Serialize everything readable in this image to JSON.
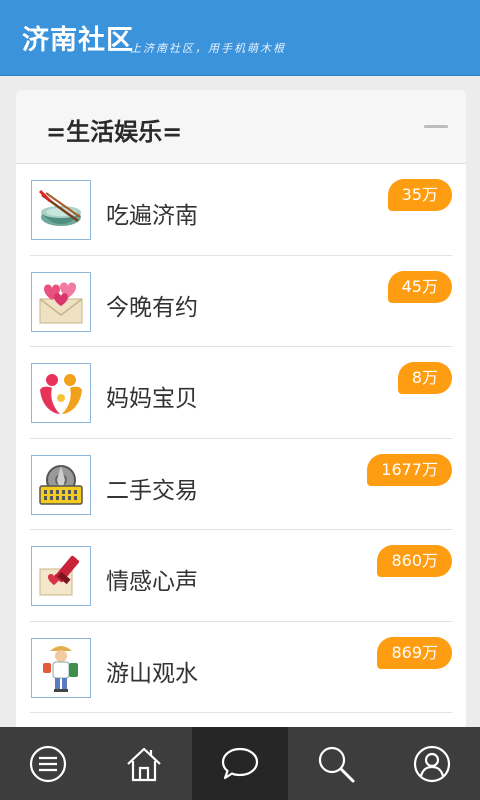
{
  "header": {
    "title": "济南社区",
    "slogan": "上济南社区，用手机萌木根"
  },
  "section": {
    "title": "=生活娱乐="
  },
  "forums": [
    {
      "label": "吃遍济南",
      "count": "35万",
      "icon": "food-bowl-icon"
    },
    {
      "label": "今晚有约",
      "count": "45万",
      "icon": "love-letter-icon"
    },
    {
      "label": "妈妈宝贝",
      "count": "8万",
      "icon": "mother-baby-icon"
    },
    {
      "label": "二手交易",
      "count": "1677万",
      "icon": "shopping-basket-icon"
    },
    {
      "label": "情感心声",
      "count": "860万",
      "icon": "heart-stamp-icon"
    },
    {
      "label": "游山观水",
      "count": "869万",
      "icon": "traveler-icon"
    }
  ],
  "tabbar": {
    "items": [
      {
        "icon": "menu-icon",
        "active": false
      },
      {
        "icon": "home-icon",
        "active": false
      },
      {
        "icon": "chat-icon",
        "active": true
      },
      {
        "icon": "search-icon",
        "active": false
      },
      {
        "icon": "user-icon",
        "active": false
      }
    ]
  },
  "colors": {
    "header_bg": "#3a93db",
    "badge_bg": "#ff9d12",
    "tabbar_bg": "#3d3d3d",
    "tabbar_active_bg": "#262626"
  }
}
